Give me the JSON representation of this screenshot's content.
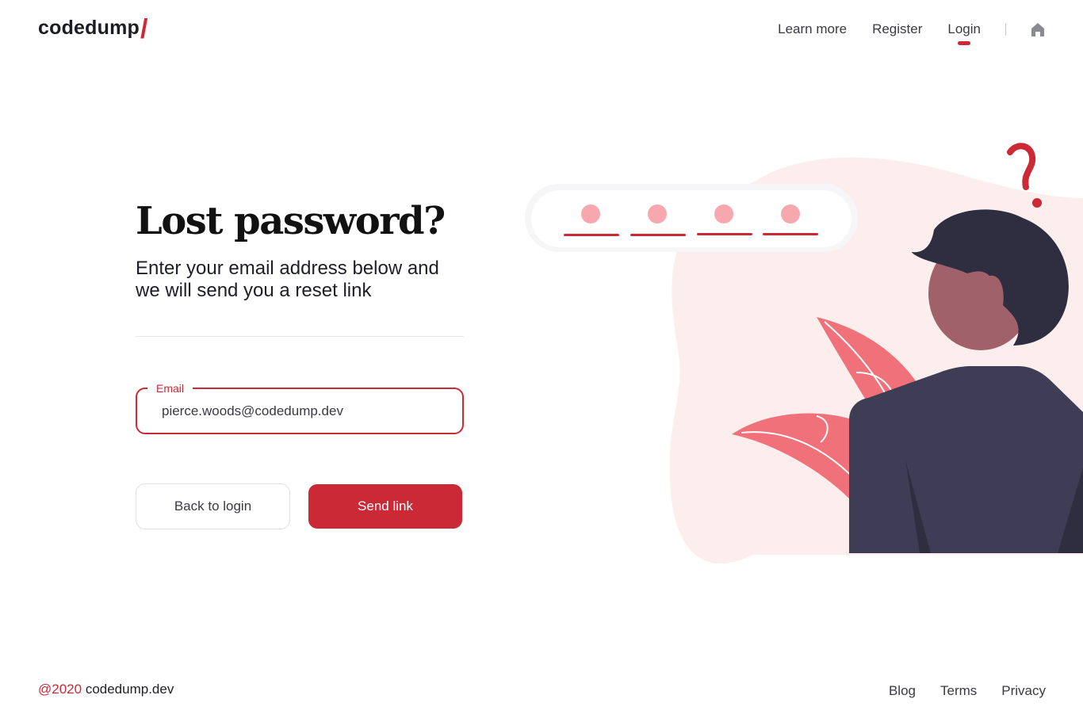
{
  "brand": {
    "name": "codedump",
    "slash": "/"
  },
  "nav": {
    "items": [
      {
        "label": "Learn more"
      },
      {
        "label": "Register"
      },
      {
        "label": "Login"
      }
    ],
    "active": "Login"
  },
  "form": {
    "title": "Lost password?",
    "subtitle": "Enter your email address below and we will send you a reset link",
    "email_label": "Email",
    "email_value": "pierce.woods@codedump.dev",
    "back_button": "Back to login",
    "send_button": "Send link"
  },
  "footer": {
    "year": "@2020",
    "domain": "codedump.dev",
    "links": [
      "Blog",
      "Terms",
      "Privacy"
    ]
  },
  "colors": {
    "accent": "#cc2936",
    "dark": "#1c1c24",
    "blob": "#fdeeee",
    "leaf": "#f0717a",
    "suit": "#3f3d56"
  },
  "icons": {
    "home": "home-icon"
  }
}
